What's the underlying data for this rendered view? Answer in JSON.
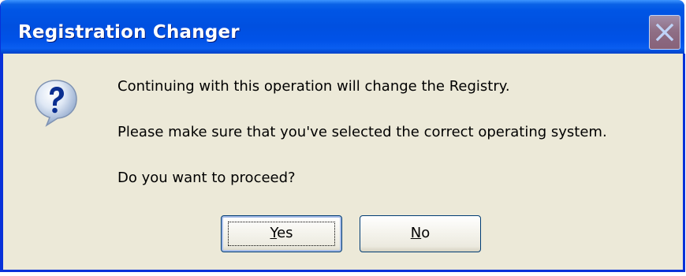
{
  "dialog": {
    "title": "Registration Changer",
    "close_icon": "close-icon",
    "icon": "question-icon",
    "messages": [
      "Continuing with this operation will change the Registry.",
      "Please make sure that you've selected the correct operating system.",
      "Do you want to proceed?"
    ],
    "buttons": {
      "yes": {
        "mnemonic": "Y",
        "rest": "es",
        "label": "Yes"
      },
      "no": {
        "mnemonic": "N",
        "rest": "o",
        "label": "No"
      }
    },
    "colors": {
      "titlebar": "#0055e5",
      "frame": "#0831d9",
      "body": "#ece9d8"
    }
  }
}
